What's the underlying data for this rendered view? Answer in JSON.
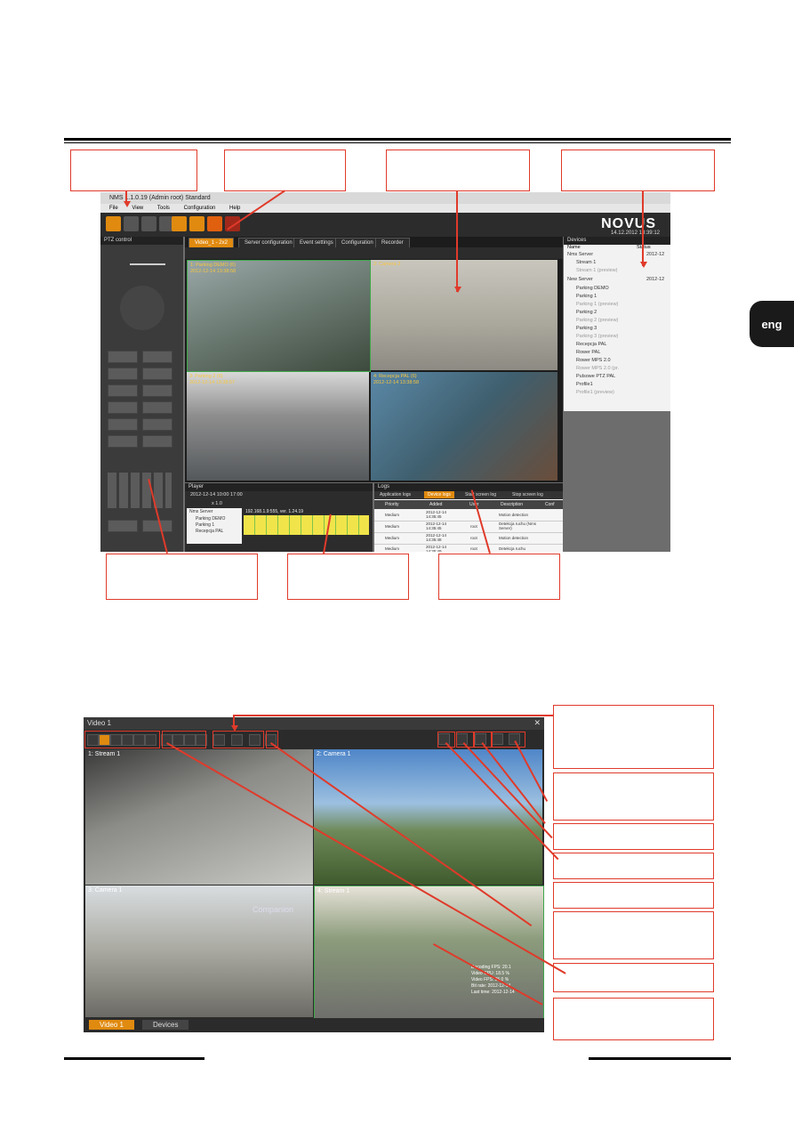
{
  "side_tab": {
    "label": "eng"
  },
  "screenshot_top": {
    "title": "NMS 1.1.0.19 (Admin root) Standard",
    "menu": [
      "File",
      "View",
      "Tools",
      "Configuration",
      "Help"
    ],
    "logo": "NOVUS",
    "datetime": "14.12.2012 13:39:12",
    "ptz_panel_title": "PTZ control",
    "video_tabs": [
      "Video_1 - 2x2",
      "Server configuration",
      "Event settings",
      "Configuration",
      "Recorder"
    ],
    "cameras": [
      {
        "label": "1: Parking DEMO (6)",
        "stamp": "2012-12-14 13:38:58"
      },
      {
        "label": "2: Camera 3",
        "stamp": ""
      },
      {
        "label": "3: Parking 2 (6)",
        "stamp": "2012-12-14 13:38:57"
      },
      {
        "label": "4: Recepcja PAL (6)",
        "stamp": "2012-12-14 13:38:58"
      }
    ],
    "devices_panel": {
      "title": "Devices",
      "columns": [
        "Name",
        "Status"
      ],
      "rows": [
        "Nms Server",
        "Stream 1",
        "Stream 1 (preview)",
        "New Server",
        "Parking DEMO",
        "Parking 1",
        "Parking 1 (preview)",
        "Parking 2",
        "Parking 2 (preview)",
        "Parking 3",
        "Parking 3 (preview)",
        "Recepcja PAL",
        "Rower PAL",
        "Rower MPS 2.0",
        "Rower MPS 2.0 (pr.",
        "Pulsowe PTZ PAL",
        "Profile1",
        "Profile1 (preview)"
      ],
      "status_values": [
        "2012-12",
        "2012-12"
      ]
    },
    "player_panel": {
      "title": "Player",
      "date": "2012-12-14 10:00 17:00",
      "speed": "x 1.0",
      "hours": [
        "0",
        "1",
        "2",
        "3",
        "4",
        "5",
        "6",
        "7",
        "8",
        "9",
        "10"
      ],
      "tree": [
        "Nms Server",
        "Parking DEMO",
        "Parking 1",
        "Recepcja PAL"
      ],
      "server_info": "192.168.1.9:555, ver. 1.24.19"
    },
    "logs_panel": {
      "title": "Logs",
      "tabs": [
        "Application logs",
        "Device logs",
        "Start screen log",
        "Stop screen log"
      ],
      "columns": [
        "Priority",
        "Added",
        "User",
        "Description",
        "Conf"
      ],
      "rows": [
        {
          "priority": "Medium",
          "added": "2012-12-14 14:35:45",
          "user": "",
          "description": "Motion detection"
        },
        {
          "priority": "Medium",
          "added": "2012-12-14 14:35:45",
          "user": "root",
          "description": "Detekcja ruchu (Nms Server)"
        },
        {
          "priority": "Medium",
          "added": "2012-12-14 14:35:48",
          "user": "root",
          "description": "Motion detection"
        },
        {
          "priority": "Medium",
          "added": "2012-12-14 14:35:49",
          "user": "root",
          "description": "Detekcja ruchu"
        }
      ]
    }
  },
  "screenshot_bottom": {
    "title": "Video 1",
    "cameras": [
      {
        "label": "1: Stream 1"
      },
      {
        "label": "2: Camera 1"
      },
      {
        "label": "3: Camera 1"
      },
      {
        "label": "4: Stream 1"
      }
    ],
    "overlay_brand": "Companion",
    "camera4_stats": [
      "Decoding FPS: 20.1",
      "Video CPU: 18.5 %",
      "Video FPS: 25.0 %",
      "Bit rate: 2012-12-14",
      "Last time: 2012-12-14"
    ],
    "bottom_tabs": [
      "Video 1",
      "Devices"
    ]
  },
  "colors": {
    "callout": "#e03a2a",
    "accent": "#e08a10",
    "panel": "#3b3b3b"
  }
}
